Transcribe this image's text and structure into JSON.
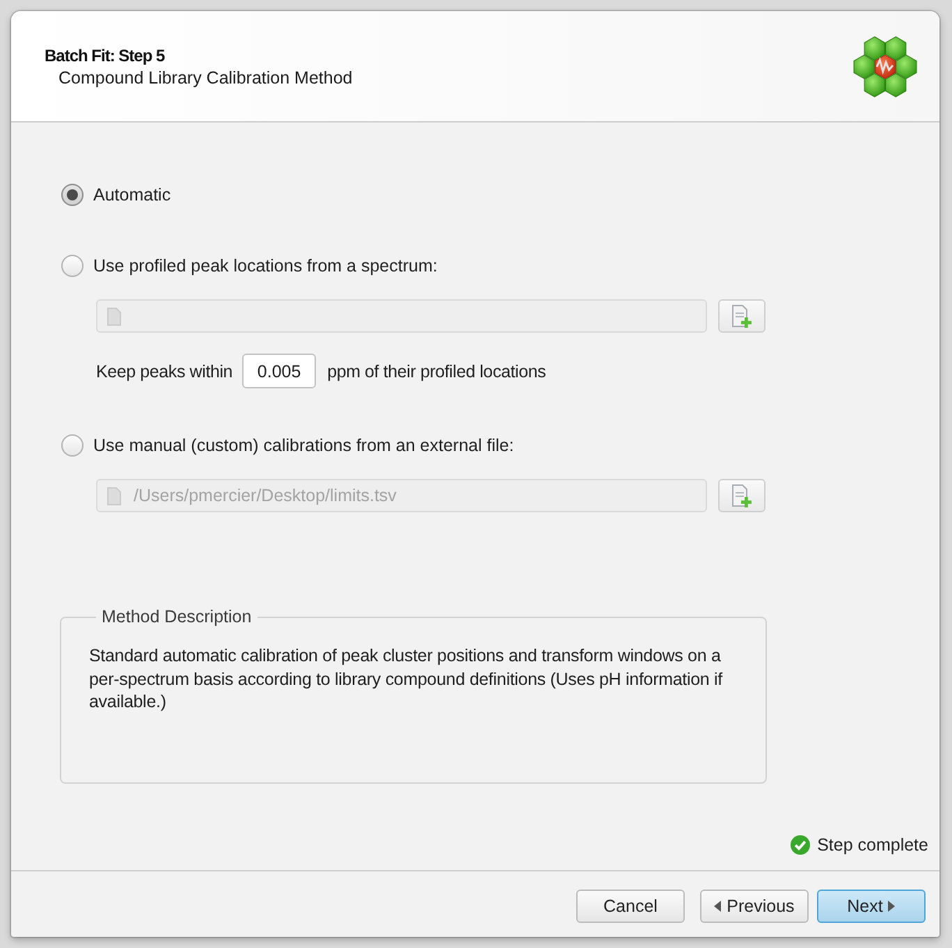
{
  "header": {
    "title": "Batch Fit: Step 5",
    "subtitle": "Compound Library Calibration Method"
  },
  "options": [
    {
      "kind": "plain",
      "label": "Automatic",
      "selected": true
    },
    {
      "kind": "file",
      "label": "Use profiled peak locations from a spectrum:",
      "selected": false,
      "file_field": {
        "disabled": true
      },
      "tolerance": {
        "prefix": "Keep peaks within",
        "value": "0.005",
        "suffix": "ppm of their profiled locations"
      }
    },
    {
      "kind": "file",
      "label": "Use manual (custom) calibrations from an external file:",
      "selected": false,
      "file_field": {
        "path": "/Users/pmercier/Desktop/limits.tsv",
        "disabled": true
      }
    }
  ],
  "method_description": {
    "legend": "Method Description",
    "text": "Standard automatic calibration of peak cluster positions and transform windows on a per-spectrum basis according to library compound definitions (Uses pH information if available.)"
  },
  "status": {
    "text": "Step complete",
    "complete": true
  },
  "buttons": [
    {
      "kind": "cancel",
      "label": "Cancel",
      "default": false
    },
    {
      "kind": "previous",
      "label": "Previous",
      "default": false
    },
    {
      "kind": "next",
      "label": "Next",
      "default": true
    }
  ]
}
